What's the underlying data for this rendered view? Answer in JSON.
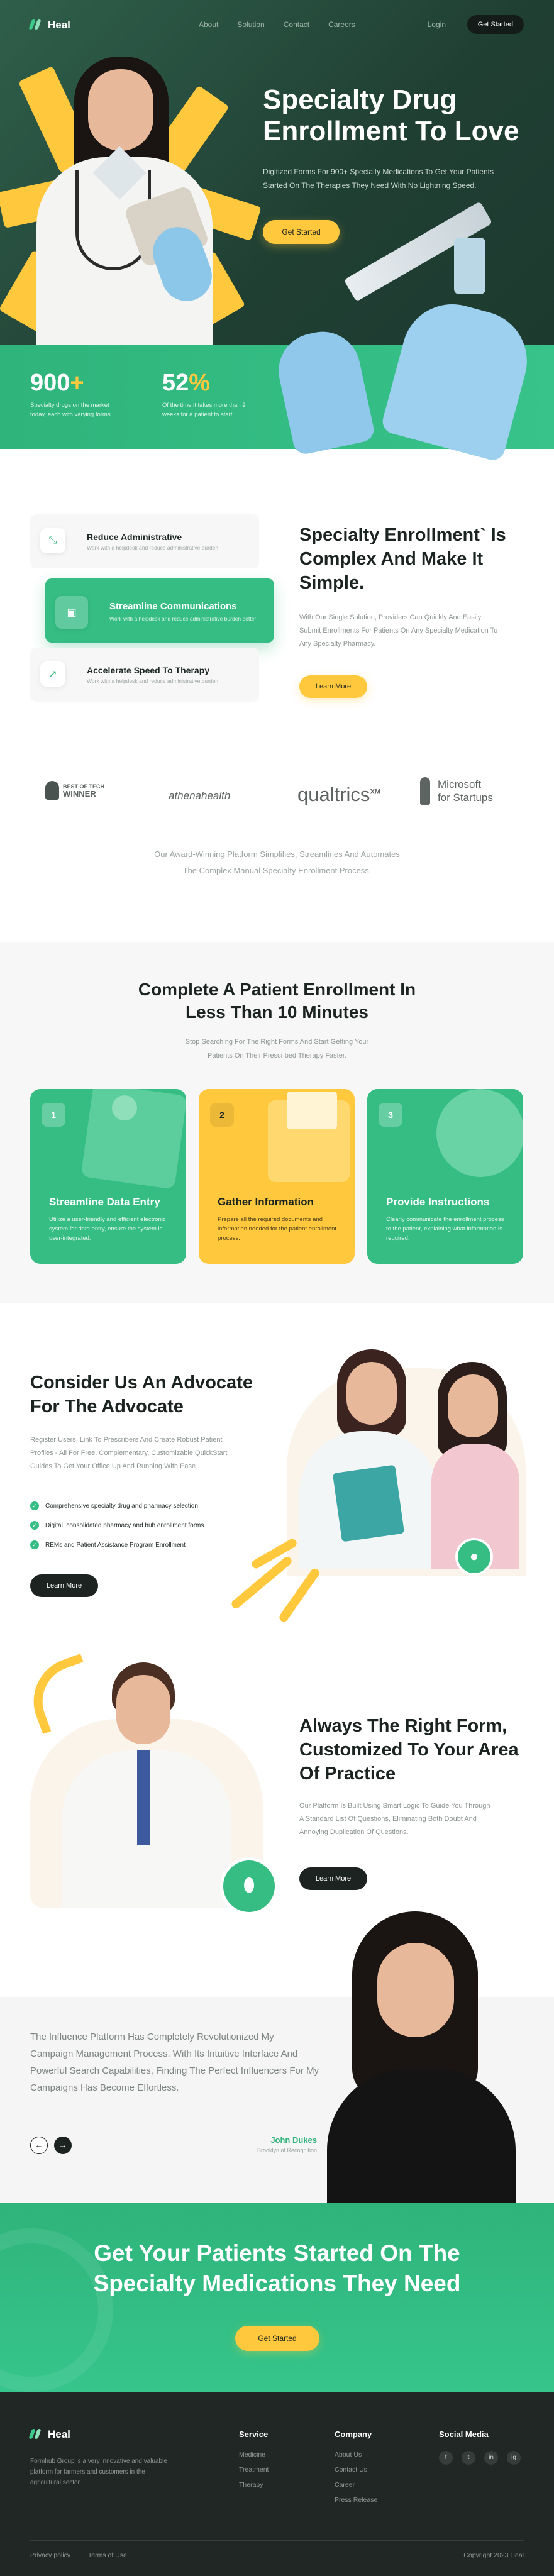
{
  "nav": {
    "brand": "Heal",
    "links": [
      "About",
      "Solution",
      "Contact",
      "Careers"
    ],
    "login": "Login",
    "cta": "Get Started"
  },
  "hero": {
    "title": "Specialty Drug Enrollment To Love",
    "subtitle": "Digitized Forms For 900+ Specialty Medications To Get Your Patients Started On The Therapies They Need With No Lightning Speed.",
    "cta": "Get Started",
    "stats": [
      {
        "value": "900",
        "suffix": "+",
        "desc": "Specialty drugs on the market today, each with varying forms"
      },
      {
        "value": "52",
        "suffix": "%",
        "desc": "Of the time it takes more than 2 weeks for a patient to start"
      }
    ]
  },
  "features": {
    "items": [
      {
        "title": "Reduce Administrative",
        "desc": "Work with a helpdesk and reduce administrative burden"
      },
      {
        "title": "Streamline Communications",
        "desc": "Work with a helpdesk and reduce administrative burden better"
      },
      {
        "title": "Accelerate Speed To Therapy",
        "desc": "Work with a helpdesk and reduce administrative burden"
      }
    ],
    "title": "Specialty Enrollment` Is Complex And Make It Simple.",
    "text": "With Our Single Solution, Providers Can Quickly And Easily Submit Enrollments For Patients On Any Specialty Medication To Any Specialty Pharmacy.",
    "cta": "Learn More"
  },
  "partners": {
    "logos": [
      {
        "name": "best-of-tech",
        "line1": "BEST OF TECH",
        "line2": "WINNER"
      },
      {
        "name": "athenahealth",
        "text": "athenahealth"
      },
      {
        "name": "qualtrics",
        "text": "qualtrics",
        "sup": "XM"
      },
      {
        "name": "microsoft",
        "line1": "Microsoft",
        "line2": "for Startups"
      }
    ],
    "caption_line1": "Our Award-Winning Platform Simplifies, Streamlines And Automates",
    "caption_line2": "The Complex Manual Specialty Enrollment Process."
  },
  "steps": {
    "title": "Complete A Patient Enrollment In Less Than 10 Minutes",
    "subtitle": "Stop Searching For The Right Forms And Start Getting Your Patients On Their Prescribed Therapy Faster.",
    "cards": [
      {
        "num": "1",
        "title": "Streamline Data Entry",
        "desc": "Utilize a user-friendly and efficient electronic system for data entry, ensure the system is user-integrated."
      },
      {
        "num": "2",
        "title": "Gather Information",
        "desc": "Prepare all the required documents and information needed for the patient enrollment process."
      },
      {
        "num": "3",
        "title": "Provide Instructions",
        "desc": "Clearly communicate the enrollment process to the patient, explaining what information is required."
      }
    ]
  },
  "advocate": {
    "title": "Consider Us An Advocate For The Advocate",
    "text": "Register Users, Link To Prescribers And Create Robust Patient Profiles - All For Free. Complementary, Customizable QuickStart Guides To Get Your Office Up And Running With Ease.",
    "checks": [
      "Comprehensive specialty drug and pharmacy selection",
      "Digital, consolidated pharmacy and hub enrollment forms",
      "REMs and Patient Assistance Program Enrollment"
    ],
    "cta": "Learn More"
  },
  "rightform": {
    "title": "Always The Right Form, Customized To Your Area Of Practice",
    "text": "Our Platform Is Built Using Smart Logic To Guide You Through A Standard List Of Questions, Eliminating Both Doubt And Annoying Duplication Of Questions.",
    "cta": "Learn More"
  },
  "testimonial": {
    "quote": "The Influence Platform Has Completely Revolutionized My Campaign Management Process. With Its Intuitive Interface And Powerful Search Capabilities, Finding The Perfect Influencers For My Campaigns Has Become Effortless.",
    "name": "John Dukes",
    "role": "Brooklyn of Recognition",
    "prev": "←",
    "next": "→"
  },
  "cta": {
    "title": "Get Your Patients Started On The Specialty Medications They Need",
    "button": "Get Started"
  },
  "footer": {
    "brand": "Heal",
    "desc": "Formhub Group is a very innovative and valuable platform for farmers and customers in the agricultural sector.",
    "columns": [
      {
        "title": "Service",
        "links": [
          "Medicine",
          "Treatment",
          "Therapy"
        ]
      },
      {
        "title": "Company",
        "links": [
          "About Us",
          "Contact Us",
          "Career",
          "Press Release"
        ]
      }
    ],
    "social_title": "Social Media",
    "social": [
      "f",
      "t",
      "in",
      "ig"
    ],
    "bottom_links": [
      "Privacy policy",
      "Terms of Use"
    ],
    "copyright": "Copyright 2023 Heal"
  },
  "colors": {
    "green": "#35bd84",
    "dark_green": "#203f33",
    "yellow": "#ffc83d",
    "dark": "#212725"
  }
}
